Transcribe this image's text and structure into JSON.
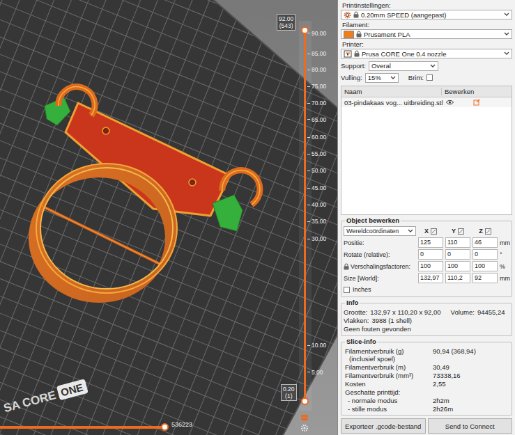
{
  "viewport": {
    "bed_logo": {
      "text": "SA CORE",
      "badge": "ONE"
    },
    "layer_slider": {
      "upper_value": "92.00",
      "upper_layer": "(543)",
      "lower_value": "0.20",
      "lower_layer": "(1)",
      "upper_level": 1,
      "lower_level": 0,
      "ticks": [
        {
          "label": "90.00",
          "level": 0.991
        },
        {
          "label": "85.00",
          "level": 0.936
        },
        {
          "label": "80.00",
          "level": 0.893
        },
        {
          "label": "75.00",
          "level": 0.848
        },
        {
          "label": "70.00",
          "level": 0.803
        },
        {
          "label": "65.00",
          "level": 0.758
        },
        {
          "label": "60.00",
          "level": 0.711
        },
        {
          "label": "55.00",
          "level": 0.666
        },
        {
          "label": "50.00",
          "level": 0.621
        },
        {
          "label": "45.00",
          "level": 0.574
        },
        {
          "label": "40.00",
          "level": 0.529
        },
        {
          "label": "35.00",
          "level": 0.484
        },
        {
          "label": "30.00",
          "level": 0.437
        },
        {
          "label": "10.00",
          "level": 0.15
        },
        {
          "label": "5.00",
          "level": 0.077
        }
      ]
    },
    "move_slider": {
      "value": "536223",
      "level": 1
    }
  },
  "sidebar": {
    "presets": [
      {
        "label": "Printinstellingen:",
        "value": "0.20mm SPEED (aangepast)",
        "kind": "print"
      },
      {
        "label": "Filament:",
        "value": "Prusament PLA",
        "kind": "filament",
        "color": "#f07d1a"
      },
      {
        "label": "Printer:",
        "value": "Prusa CORE One 0.4 nozzle",
        "kind": "printer"
      }
    ],
    "support": {
      "label": "Support:",
      "value": "Overal"
    },
    "infill": {
      "label": "Vulling:",
      "value": "15%"
    },
    "brim": {
      "label": "Brim:",
      "checked": false
    },
    "object_list": {
      "columns": [
        "Naam",
        "Bewerken"
      ],
      "rows": [
        {
          "name": "03-pindakaas vog... uitbreiding.stl",
          "selected": false
        }
      ]
    },
    "object_manipulation": {
      "title": "Object bewerken",
      "coordinates": "Wereldcoördinaten",
      "axes": [
        "X",
        "Y",
        "Z"
      ],
      "rows": [
        {
          "label": "Positie:",
          "values": [
            "125",
            "110",
            "46"
          ],
          "unit": "mm",
          "locked": false
        },
        {
          "label": "Rotate (relative):",
          "values": [
            "0",
            "0",
            "0"
          ],
          "unit": "°",
          "locked": false
        },
        {
          "label": "Verschalingsfactoren:",
          "values": [
            "100",
            "100",
            "100"
          ],
          "unit": "%",
          "locked": true
        },
        {
          "label": "Size [World]:",
          "values": [
            "132,97",
            "110,2",
            "92"
          ],
          "unit": "mm",
          "locked": false
        }
      ],
      "inches": {
        "label": "Inches",
        "checked": false
      }
    },
    "info": {
      "title": "Info",
      "size_label": "Grootte:",
      "size": "132,97 x 110,20 x 92,00",
      "volume_label": "Volume:",
      "volume": "94455,24",
      "facets_label": "Vlakken:",
      "facets": "3988 (1 shell)",
      "status": "Geen fouten gevonden"
    },
    "slice_info": {
      "title": "Slice-info",
      "rows": [
        {
          "label": "Filamentverbruik (g)",
          "sublabel": "(inclusief spoel)",
          "value": "90,94 (368,94)"
        },
        {
          "label": "Filamentverbruik (m)",
          "sublabel": "",
          "value": "30,49"
        },
        {
          "label": "Filamentverbruik (mm³)",
          "sublabel": "",
          "value": "73338,16"
        },
        {
          "label": "Kosten",
          "sublabel": "",
          "value": "2,55"
        }
      ],
      "time_label": "Geschatte printtijd:",
      "times": [
        {
          "label": "- normale modus",
          "value": "2h2m"
        },
        {
          "label": "- stille modus",
          "value": "2h26m"
        }
      ]
    },
    "buttons": [
      "Exporteer .gcode-bestand",
      "Send to Connect"
    ]
  }
}
